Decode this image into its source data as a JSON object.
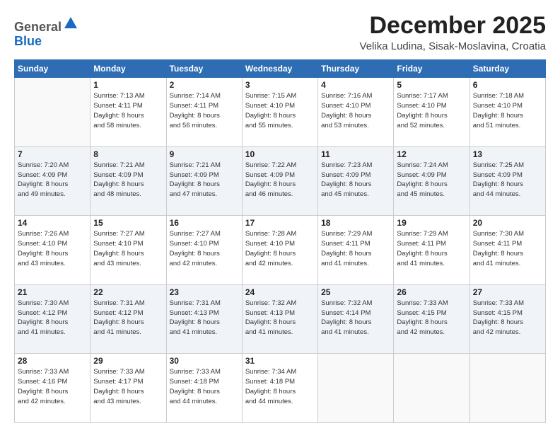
{
  "header": {
    "logo_general": "General",
    "logo_blue": "Blue",
    "month": "December 2025",
    "location": "Velika Ludina, Sisak-Moslavina, Croatia"
  },
  "days_of_week": [
    "Sunday",
    "Monday",
    "Tuesday",
    "Wednesday",
    "Thursday",
    "Friday",
    "Saturday"
  ],
  "weeks": [
    [
      {
        "day": "",
        "info": ""
      },
      {
        "day": "1",
        "info": "Sunrise: 7:13 AM\nSunset: 4:11 PM\nDaylight: 8 hours\nand 58 minutes."
      },
      {
        "day": "2",
        "info": "Sunrise: 7:14 AM\nSunset: 4:11 PM\nDaylight: 8 hours\nand 56 minutes."
      },
      {
        "day": "3",
        "info": "Sunrise: 7:15 AM\nSunset: 4:10 PM\nDaylight: 8 hours\nand 55 minutes."
      },
      {
        "day": "4",
        "info": "Sunrise: 7:16 AM\nSunset: 4:10 PM\nDaylight: 8 hours\nand 53 minutes."
      },
      {
        "day": "5",
        "info": "Sunrise: 7:17 AM\nSunset: 4:10 PM\nDaylight: 8 hours\nand 52 minutes."
      },
      {
        "day": "6",
        "info": "Sunrise: 7:18 AM\nSunset: 4:10 PM\nDaylight: 8 hours\nand 51 minutes."
      }
    ],
    [
      {
        "day": "7",
        "info": "Sunrise: 7:20 AM\nSunset: 4:09 PM\nDaylight: 8 hours\nand 49 minutes."
      },
      {
        "day": "8",
        "info": "Sunrise: 7:21 AM\nSunset: 4:09 PM\nDaylight: 8 hours\nand 48 minutes."
      },
      {
        "day": "9",
        "info": "Sunrise: 7:21 AM\nSunset: 4:09 PM\nDaylight: 8 hours\nand 47 minutes."
      },
      {
        "day": "10",
        "info": "Sunrise: 7:22 AM\nSunset: 4:09 PM\nDaylight: 8 hours\nand 46 minutes."
      },
      {
        "day": "11",
        "info": "Sunrise: 7:23 AM\nSunset: 4:09 PM\nDaylight: 8 hours\nand 45 minutes."
      },
      {
        "day": "12",
        "info": "Sunrise: 7:24 AM\nSunset: 4:09 PM\nDaylight: 8 hours\nand 45 minutes."
      },
      {
        "day": "13",
        "info": "Sunrise: 7:25 AM\nSunset: 4:09 PM\nDaylight: 8 hours\nand 44 minutes."
      }
    ],
    [
      {
        "day": "14",
        "info": "Sunrise: 7:26 AM\nSunset: 4:10 PM\nDaylight: 8 hours\nand 43 minutes."
      },
      {
        "day": "15",
        "info": "Sunrise: 7:27 AM\nSunset: 4:10 PM\nDaylight: 8 hours\nand 43 minutes."
      },
      {
        "day": "16",
        "info": "Sunrise: 7:27 AM\nSunset: 4:10 PM\nDaylight: 8 hours\nand 42 minutes."
      },
      {
        "day": "17",
        "info": "Sunrise: 7:28 AM\nSunset: 4:10 PM\nDaylight: 8 hours\nand 42 minutes."
      },
      {
        "day": "18",
        "info": "Sunrise: 7:29 AM\nSunset: 4:11 PM\nDaylight: 8 hours\nand 41 minutes."
      },
      {
        "day": "19",
        "info": "Sunrise: 7:29 AM\nSunset: 4:11 PM\nDaylight: 8 hours\nand 41 minutes."
      },
      {
        "day": "20",
        "info": "Sunrise: 7:30 AM\nSunset: 4:11 PM\nDaylight: 8 hours\nand 41 minutes."
      }
    ],
    [
      {
        "day": "21",
        "info": "Sunrise: 7:30 AM\nSunset: 4:12 PM\nDaylight: 8 hours\nand 41 minutes."
      },
      {
        "day": "22",
        "info": "Sunrise: 7:31 AM\nSunset: 4:12 PM\nDaylight: 8 hours\nand 41 minutes."
      },
      {
        "day": "23",
        "info": "Sunrise: 7:31 AM\nSunset: 4:13 PM\nDaylight: 8 hours\nand 41 minutes."
      },
      {
        "day": "24",
        "info": "Sunrise: 7:32 AM\nSunset: 4:13 PM\nDaylight: 8 hours\nand 41 minutes."
      },
      {
        "day": "25",
        "info": "Sunrise: 7:32 AM\nSunset: 4:14 PM\nDaylight: 8 hours\nand 41 minutes."
      },
      {
        "day": "26",
        "info": "Sunrise: 7:33 AM\nSunset: 4:15 PM\nDaylight: 8 hours\nand 42 minutes."
      },
      {
        "day": "27",
        "info": "Sunrise: 7:33 AM\nSunset: 4:15 PM\nDaylight: 8 hours\nand 42 minutes."
      }
    ],
    [
      {
        "day": "28",
        "info": "Sunrise: 7:33 AM\nSunset: 4:16 PM\nDaylight: 8 hours\nand 42 minutes."
      },
      {
        "day": "29",
        "info": "Sunrise: 7:33 AM\nSunset: 4:17 PM\nDaylight: 8 hours\nand 43 minutes."
      },
      {
        "day": "30",
        "info": "Sunrise: 7:33 AM\nSunset: 4:18 PM\nDaylight: 8 hours\nand 44 minutes."
      },
      {
        "day": "31",
        "info": "Sunrise: 7:34 AM\nSunset: 4:18 PM\nDaylight: 8 hours\nand 44 minutes."
      },
      {
        "day": "",
        "info": ""
      },
      {
        "day": "",
        "info": ""
      },
      {
        "day": "",
        "info": ""
      }
    ]
  ]
}
